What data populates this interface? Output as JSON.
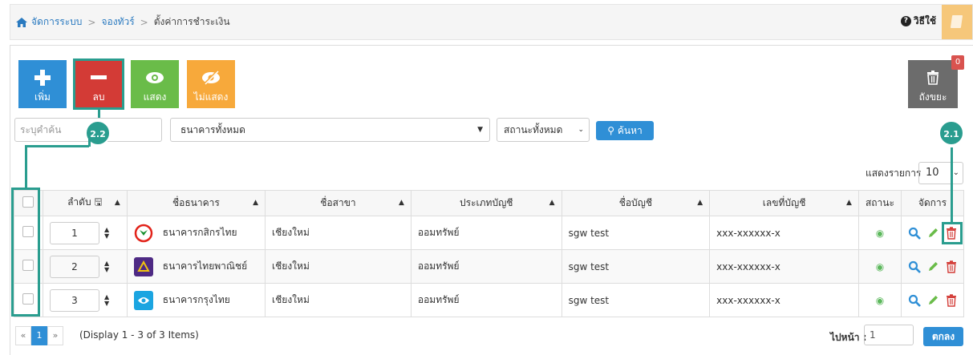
{
  "breadcrumb": {
    "home": "จัดการระบบ",
    "section": "จองทัวร์",
    "current": "ตั้งค่าการชำระเงิน"
  },
  "help_label": "วิธีใช้",
  "toolbar": {
    "add": "เพิ่ม",
    "delete": "ลบ",
    "show": "แสดง",
    "hide": "ไม่แสดง",
    "trash": "ถังขยะ",
    "trash_count": "0"
  },
  "callouts": {
    "delete": "2.2",
    "row_delete": "2.1"
  },
  "filters": {
    "keyword_placeholder": "ระบุคำค้น",
    "bank": "ธนาคารทั้งหมด",
    "status": "สถานะทั้งหมด",
    "search": "ค้นหา"
  },
  "page_size": {
    "label": "แสดงรายการ",
    "value": "10"
  },
  "table": {
    "headers": {
      "order": "ลำดับ",
      "bank": "ชื่อธนาคาร",
      "branch": "ชื่อสาขา",
      "type": "ประเภทบัญชี",
      "account_name": "ชื่อบัญชี",
      "account_no": "เลขที่บัญชี",
      "status": "สถานะ",
      "manage": "จัดการ"
    },
    "rows": [
      {
        "order": "1",
        "bank": "ธนาคารกสิกรไทย",
        "branch": "เชียงใหม่",
        "type": "ออมทรัพย์",
        "account_name": "sgw test",
        "account_no": "xxx-xxxxxx-x",
        "logo_color": "#138f2d"
      },
      {
        "order": "2",
        "bank": "ธนาคารไทยพาณิชย์",
        "branch": "เชียงใหม่",
        "type": "ออมทรัพย์",
        "account_name": "sgw test",
        "account_no": "xxx-xxxxxx-x",
        "logo_color": "#4e2a84"
      },
      {
        "order": "3",
        "bank": "ธนาคารกรุงไทย",
        "branch": "เชียงใหม่",
        "type": "ออมทรัพย์",
        "account_name": "sgw test",
        "account_no": "xxx-xxxxxx-x",
        "logo_color": "#1ba5e1"
      }
    ]
  },
  "pagination": {
    "prev": "«",
    "page": "1",
    "next": "»",
    "info": "(Display 1 - 3 of 3 Items)",
    "goto_label": "ไปหน้า :",
    "goto_value": "1",
    "go": "ตกลง"
  }
}
